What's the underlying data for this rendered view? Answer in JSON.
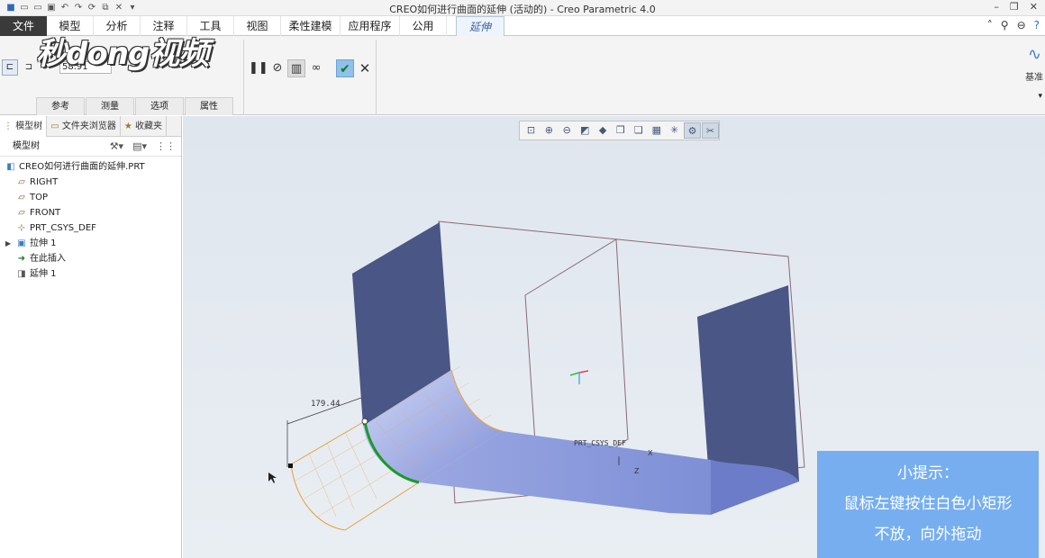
{
  "window": {
    "title": "CREO如何进行曲面的延伸 (活动的) - Creo Parametric 4.0"
  },
  "menu": {
    "file": "文件",
    "tabs": [
      "模型",
      "分析",
      "注释",
      "工具",
      "视图",
      "柔性建模",
      "应用程序",
      "公用"
    ],
    "active_tab": "延伸"
  },
  "ribbon": {
    "distance_value": "58.91",
    "subtabs": [
      "参考",
      "测量",
      "选项",
      "属性"
    ],
    "datum_label": "基准"
  },
  "watermark": "秒dong视频",
  "panel": {
    "tabs": [
      "模型树",
      "文件夹浏览器",
      "收藏夹"
    ],
    "header": "模型树",
    "tree": [
      {
        "label": "CREO如何进行曲面的延伸.PRT",
        "icon": "part-icon"
      },
      {
        "label": "RIGHT",
        "icon": "datum-plane-icon"
      },
      {
        "label": "TOP",
        "icon": "datum-plane-icon"
      },
      {
        "label": "FRONT",
        "icon": "datum-plane-icon"
      },
      {
        "label": "PRT_CSYS_DEF",
        "icon": "csys-icon"
      },
      {
        "label": "拉伸 1",
        "icon": "extrude-icon"
      },
      {
        "label": "在此插入",
        "icon": "insert-arrow-icon"
      },
      {
        "label": "延伸 1",
        "icon": "extend-icon"
      }
    ]
  },
  "viewport": {
    "dimension_label": "179.44",
    "csys_label": "PRT_CSYS_DEF",
    "axis_x": "X",
    "axis_z": "Z"
  },
  "tip": {
    "title": "小提示：",
    "line1": "鼠标左键按住白色小矩形",
    "line2": "不放，向外拖动"
  },
  "colors": {
    "surface_dark": "#4a5685",
    "surface_light": "#8797d8",
    "edge_green": "#1b9a2a",
    "tip_box": "#76aef0",
    "preview_orange": "#e8a040"
  }
}
